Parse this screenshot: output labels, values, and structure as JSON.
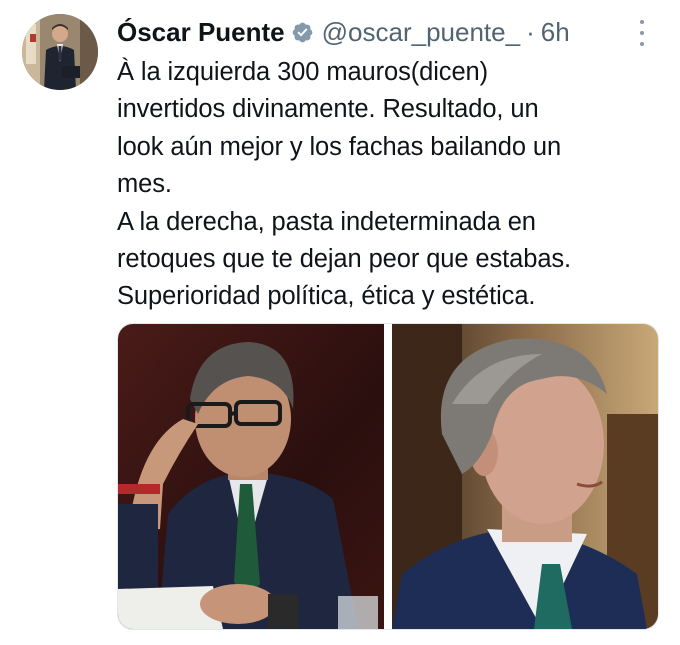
{
  "author": {
    "name": "Óscar Puente",
    "handle": "@oscar_puente_",
    "time": "6h",
    "separator": "·"
  },
  "tweet": {
    "lines": [
      "À la izquierda 300 mauros(dicen)",
      "invertidos divinamente. Resultado, un",
      "look aún mejor y los fachas bailando un",
      "mes.",
      "A la derecha, pasta indeterminada en",
      "retoques que te dejan peor que estabas.",
      "Superioridad política, ética y estética."
    ]
  },
  "icons": {
    "verified": "verified-badge-icon",
    "more": "more-options-icon"
  },
  "colors": {
    "text": "#0f1419",
    "secondary": "#536471",
    "verified_badge": "#829aab"
  }
}
